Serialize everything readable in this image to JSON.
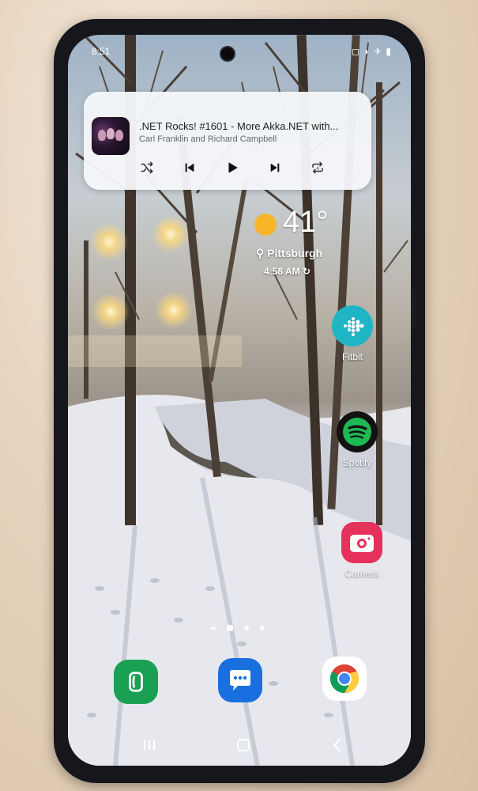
{
  "status_bar": {
    "time": "8:51",
    "right_icons": "◻ ◗ ✈ ▮"
  },
  "media": {
    "title": ".NET Rocks! #1601 - More Akka.NET with...",
    "artist": "Carl Franklin and Richard Campbell",
    "controls": [
      "shuffle-icon",
      "previous-icon",
      "play-icon",
      "next-icon",
      "repeat-icon"
    ]
  },
  "weather": {
    "temperature": "41°",
    "location": "Pittsburgh",
    "time": "4:58 AM",
    "sun_color": "#f7b52a"
  },
  "apps": [
    {
      "label": "Fitbit",
      "icon": "fitbit-icon",
      "color": "#1fb5c4"
    },
    {
      "label": "Spotify",
      "icon": "spotify-icon",
      "color": "#1db954"
    },
    {
      "label": "Camera",
      "icon": "camera-icon",
      "color": "#e5315b"
    }
  ],
  "dock": [
    {
      "icon": "phone-icon",
      "color": "#1aa053"
    },
    {
      "icon": "messages-icon",
      "color": "#1a6fe0"
    },
    {
      "icon": "chrome-icon",
      "color": "#ffffff"
    }
  ],
  "page_indicator": {
    "pages": 4,
    "current": 2
  },
  "navigation": [
    "recents-icon",
    "home-icon",
    "back-icon"
  ]
}
